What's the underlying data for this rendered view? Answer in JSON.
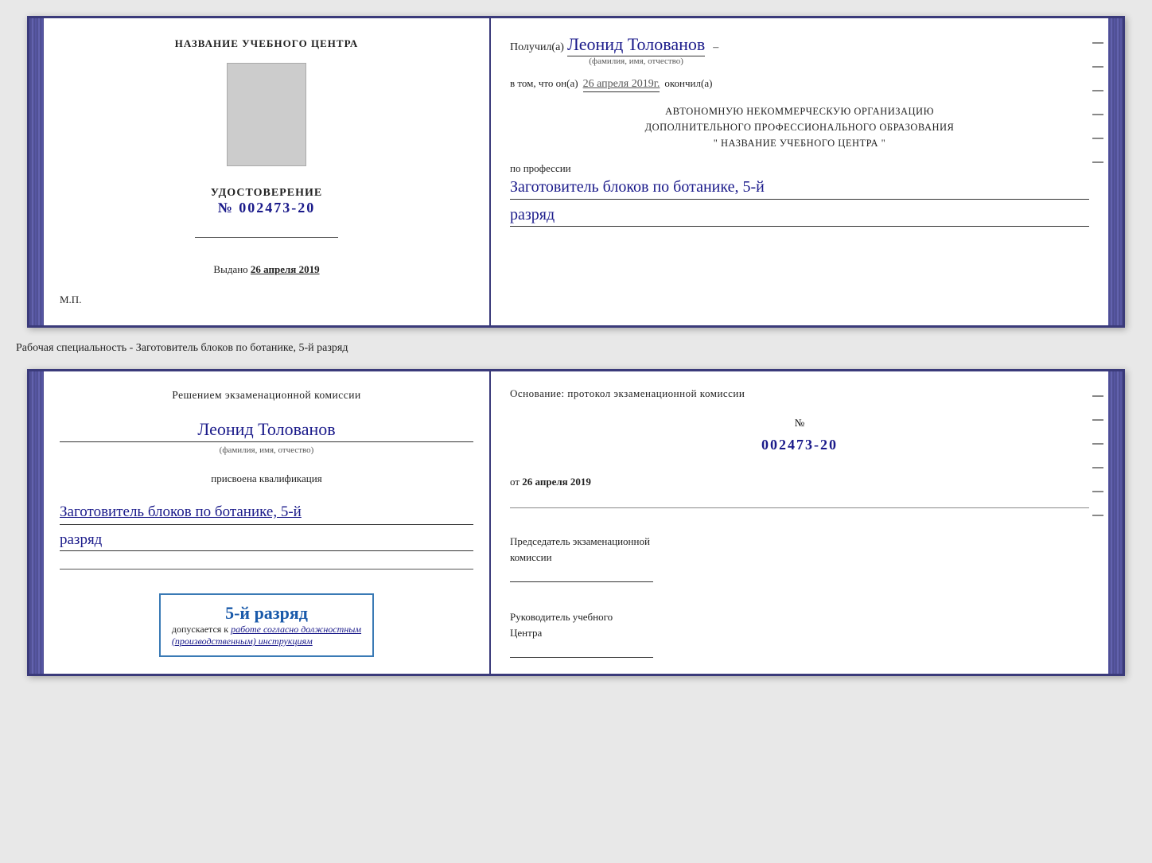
{
  "top_doc": {
    "left": {
      "title": "НАЗВАНИЕ УЧЕБНОГО ЦЕНТРА",
      "udostoverenie_label": "УДОСТОВЕРЕНИЕ",
      "number_prefix": "№",
      "number": "002473-20",
      "vydano_label": "Выдано",
      "vydano_date": "26 апреля 2019",
      "mp_label": "М.П."
    },
    "right": {
      "poluchil_prefix": "Получил(а)",
      "name": "Леонид Толованов",
      "name_subtitle": "(фамилия, имя, отчество)",
      "vtom_text": "в том, что он(а)",
      "vtom_date": "26 апреля 2019г.",
      "okonchil": "окончил(а)",
      "auto_line1": "АВТОНОМНУЮ НЕКОММЕРЧЕСКУЮ ОРГАНИЗАЦИЮ",
      "auto_line2": "ДОПОЛНИТЕЛЬНОГО ПРОФЕССИОНАЛЬНОГО ОБРАЗОВАНИЯ",
      "auto_line3": "\"  НАЗВАНИЕ УЧЕБНОГО ЦЕНТРА  \"",
      "po_professii_label": "по профессии",
      "profession": "Заготовитель блоков по ботанике, 5-й",
      "razryad": "разряд"
    }
  },
  "specialty_label": "Рабочая специальность - Заготовитель блоков по ботанике, 5-й разряд",
  "bottom_doc": {
    "left": {
      "resheniyem_text": "Решением экзаменационной комиссии",
      "name": "Леонид Толованов",
      "name_subtitle": "(фамилия, имя, отчество)",
      "prisvoena_text": "присвоена квалификация",
      "profession": "Заготовитель блоков по ботанике, 5-й",
      "razryad": "разряд",
      "stamp_text": "5-й разряд",
      "dopuskaetsya_prefix": "допускается к",
      "dopuskaetsya_italic": "работе согласно должностным",
      "dopuskaetsya_italic2": "(производственным) инструкциям"
    },
    "right": {
      "osnovanie_label": "Основание: протокол экзаменационной комиссии",
      "number_prefix": "№",
      "number": "002473-20",
      "ot_label": "от",
      "ot_date": "26 апреля 2019",
      "predsedatel_label": "Председатель экзаменационной",
      "predsedatel_label2": "комиссии",
      "rukovoditel_label": "Руководитель учебного",
      "rukovoditel_label2": "Центра"
    }
  }
}
